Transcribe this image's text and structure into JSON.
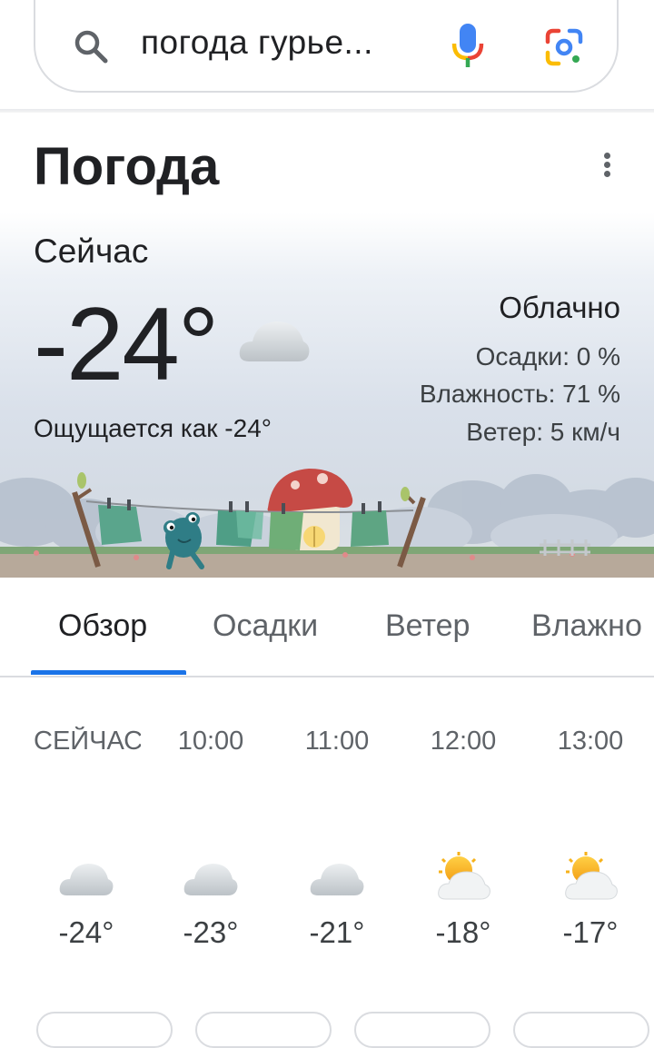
{
  "search": {
    "query": "погода гурье..."
  },
  "weather": {
    "title": "Погода",
    "now_label": "Сейчас",
    "temperature": "-24°",
    "feels_like": "Ощущается как -24°",
    "condition": "Облачно",
    "precipitation": "Осадки: 0 %",
    "humidity": "Влажность: 71 %",
    "wind": "Ветер: 5 км/ч"
  },
  "tabs": [
    {
      "label": "Обзор",
      "active": true
    },
    {
      "label": "Осадки",
      "active": false
    },
    {
      "label": "Ветер",
      "active": false
    },
    {
      "label": "Влажно",
      "active": false
    }
  ],
  "hourly": [
    {
      "time": "СЕЙЧАС",
      "icon": "cloudy-icon",
      "temp": "-24°"
    },
    {
      "time": "10:00",
      "icon": "cloudy-icon",
      "temp": "-23°"
    },
    {
      "time": "11:00",
      "icon": "cloudy-icon",
      "temp": "-21°"
    },
    {
      "time": "12:00",
      "icon": "partly-cloudy-icon",
      "temp": "-18°"
    },
    {
      "time": "13:00",
      "icon": "partly-cloudy-icon",
      "temp": "-17°"
    }
  ],
  "colors": {
    "accent": "#1a73e8",
    "text": "#202124",
    "muted": "#5f6368",
    "divider": "#dadce0"
  }
}
